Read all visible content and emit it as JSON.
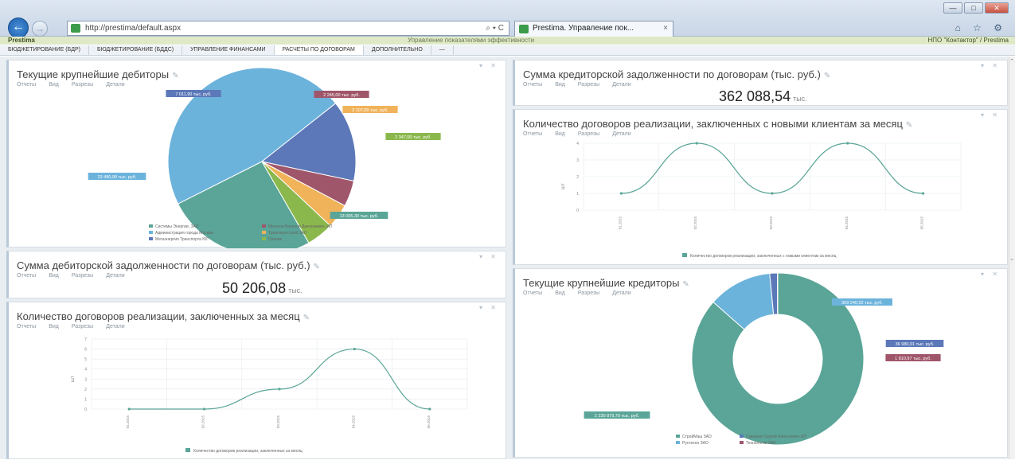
{
  "browser": {
    "url": "http://prestima/default.aspx",
    "address_icons": "⌕ ▾ C",
    "tab_title": "Prestima. Управление пок...",
    "tab_close": "×",
    "tools": "⌂ ☆ ⚙",
    "win_min": "—",
    "win_max": "□",
    "win_close": "✕",
    "back": "←",
    "forward": "→"
  },
  "app": {
    "logo": "Prestima",
    "caption": "Управление показателями эффективности",
    "user": "НПО \"Контактор\" / Prestima"
  },
  "module_tabs": [
    {
      "label": "Бюджетирование (БДР)"
    },
    {
      "label": "Бюджетирование (БДДС)"
    },
    {
      "label": "Управление финансами"
    },
    {
      "label": "Расчеты по договорам"
    },
    {
      "label": "Дополнительно"
    },
    {
      "label": "—"
    }
  ],
  "card_links": [
    "Отчеты",
    "Вид",
    "Разрезы",
    "Детали"
  ],
  "cards": {
    "debtors": {
      "title": "Текущие крупнейшие дебиторы",
      "legend": [
        "Системы Энергии, ЗАО",
        "Администрация города Москвы",
        "Мегаэнергия Транспорта ЮГ",
        "Мигунов Василий Дмитриевич, ИП",
        "Транспортстрой ЗАО",
        "Прочие"
      ],
      "labels": [
        "7 011,90 тыс. руб.",
        "2 245,00 тыс. руб.",
        "2 107,00 тыс. руб.",
        "2 347,00 тыс. руб.",
        "13 005,30 тыс. руб.",
        "23 480,90 тыс. руб."
      ]
    },
    "receivables": {
      "title": "Сумма дебиторской задолженности по договорам (тыс. руб.)",
      "value": "50 206,08",
      "unit": "тыс."
    },
    "contracts_month": {
      "title": "Количество договоров реализации, заключенных за месяц",
      "ylabel": "шт",
      "legend": "Количество договоров реализации, заключенных за месяц"
    },
    "payables": {
      "title": "Сумма кредиторской задолженности по договорам (тыс. руб.)",
      "value": "362 088,54",
      "unit": "тыс."
    },
    "new_clients": {
      "title": "Количество договоров реализации, заключенных с новыми клиентам за месяц",
      "ylabel": "шт",
      "legend": "Количество договоров реализации, заключенных с новыми клиентам за месяц"
    },
    "creditors": {
      "title": "Текущие крупнейшие кредиторы",
      "legend": [
        "СтройМаш ЗАО",
        "Рустехно ЗАО",
        "Смирнов Сергей Алексеевич ИП",
        "Технологии ЗАО"
      ],
      "labels": [
        "2 230 879,70 тыс. руб.",
        "309 240,52 тыс. руб.",
        "36 980,01 тыс. руб.",
        "1 810,97 тыс. руб."
      ]
    }
  },
  "chart_data": [
    {
      "type": "pie",
      "title": "Текущие крупнейшие дебиторы",
      "categories": [
        "Системы Энергии, ЗАО",
        "Администрация города Москвы",
        "Мегаэнергия Транспорта ЮГ",
        "Мигунов Василий Дмитриевич, ИП",
        "Транспортстрой ЗАО",
        "Прочие"
      ],
      "values": [
        13005.3,
        23480.9,
        7011.9,
        2245.0,
        2107.0,
        2347.0
      ],
      "colors": [
        "#5aa597",
        "#6cb3dc",
        "#5c78b8",
        "#a0566a",
        "#f0b35a",
        "#8bb84d"
      ]
    },
    {
      "type": "line",
      "title": "Количество договоров реализации, заключенных за месяц",
      "categories": [
        "01.2015",
        "02.2015",
        "03.2015",
        "04.2015",
        "05.2015"
      ],
      "values": [
        0,
        0,
        2,
        6,
        0
      ],
      "ylabel": "шт",
      "ylim": [
        0,
        7
      ],
      "yticks": [
        0,
        1,
        2,
        3,
        4,
        5,
        6,
        7
      ]
    },
    {
      "type": "line",
      "title": "Количество договоров реализации, заключенных с новыми клиентам за месяц",
      "categories": [
        "01.2015",
        "02.2015",
        "03.2015",
        "04.2015",
        "05.2015"
      ],
      "values": [
        1,
        4,
        1,
        4,
        1
      ],
      "ylabel": "шт",
      "ylim": [
        0,
        4
      ],
      "yticks": [
        0,
        1,
        2,
        3,
        4
      ]
    },
    {
      "type": "pie",
      "title": "Текущие крупнейшие кредиторы",
      "categories": [
        "СтройМаш ЗАО",
        "Рустехно ЗАО",
        "Смирнов Сергей Алексеевич ИП",
        "Технологии ЗАО"
      ],
      "values": [
        2230879.7,
        309240.52,
        36980.01,
        1810.97
      ],
      "colors": [
        "#5aa597",
        "#6cb3dc",
        "#5c78b8",
        "#a0566a"
      ]
    }
  ]
}
